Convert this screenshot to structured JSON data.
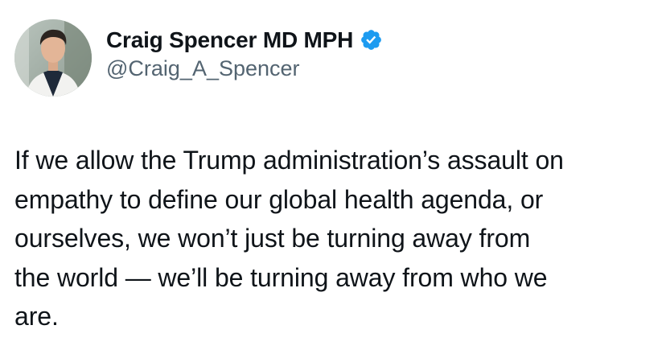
{
  "author": {
    "display_name": "Craig Spencer MD MPH",
    "handle": "@Craig_A_Spencer",
    "verified_icon": "verified-badge-icon",
    "verified_color": "#1d9bf0"
  },
  "tweet": {
    "text": "If we allow the Trump administration’s assault on\nempathy to define our global health agenda, or\nourselves, we won’t just be turning away from\nthe world — we’ll be turning away from who we\nare."
  },
  "colors": {
    "text": "#0f1419",
    "secondary_text": "#536471",
    "background": "#ffffff"
  }
}
